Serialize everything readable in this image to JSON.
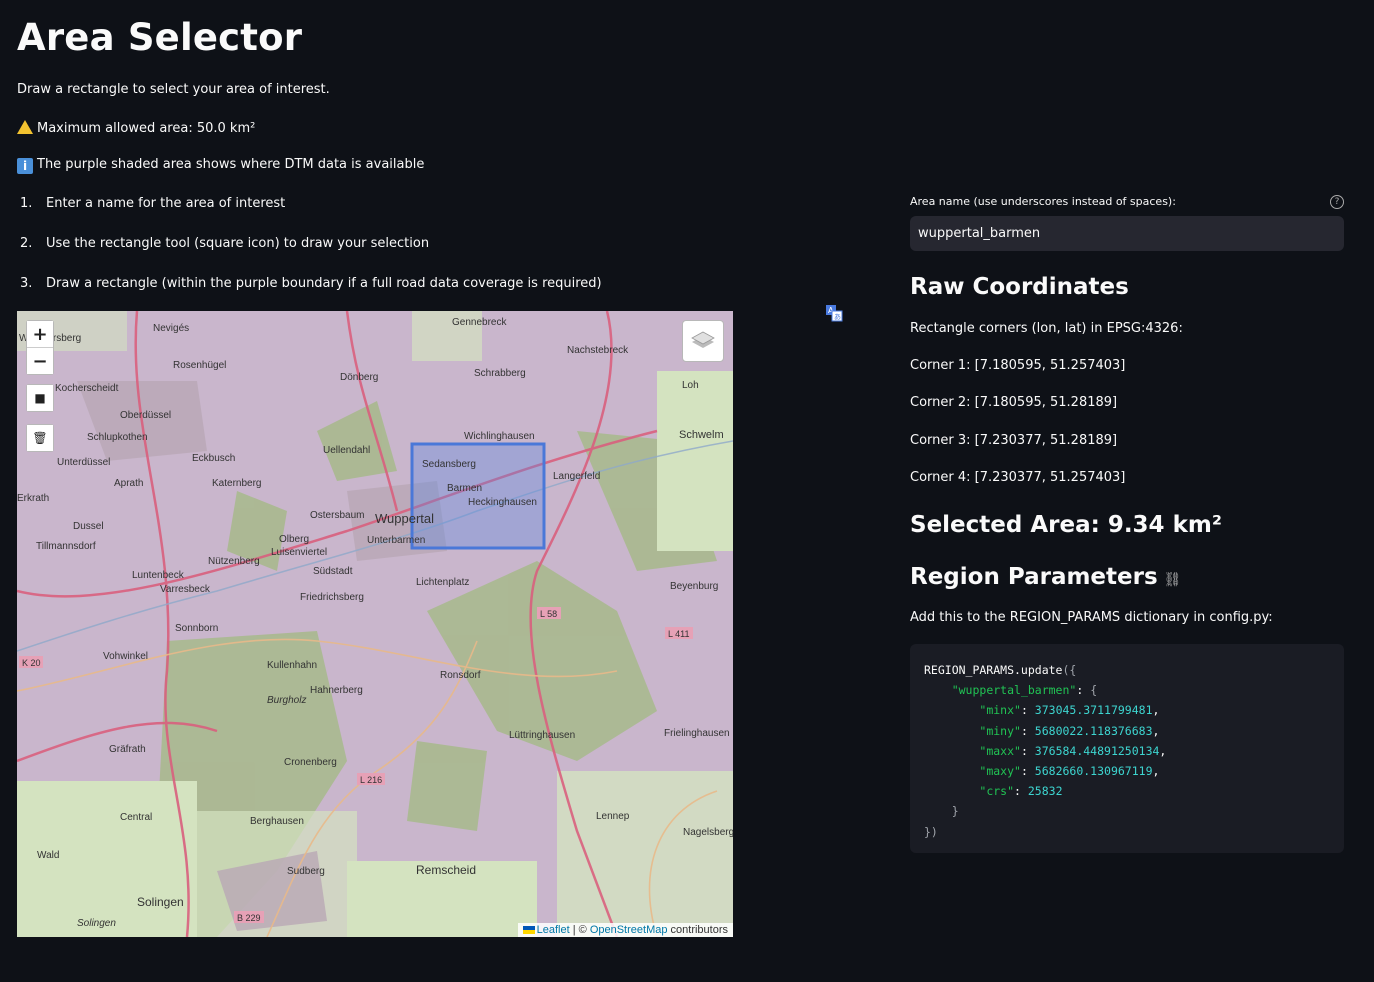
{
  "header": {
    "title": "Area Selector",
    "subtitle": "Draw a rectangle to select your area of interest.",
    "warning": "Maximum allowed area: 50.0 km²",
    "info": "The purple shaded area shows where DTM data is available"
  },
  "steps": [
    {
      "num": "1.",
      "text": "Enter a name for the area of interest"
    },
    {
      "num": "2.",
      "text": "Use the rectangle tool (square icon) to draw your selection"
    },
    {
      "num": "3.",
      "text": "Draw a rectangle (within the purple boundary if a full road data coverage is required)"
    }
  ],
  "map": {
    "zoom_in": "+",
    "zoom_out": "−",
    "draw_rect": "■",
    "delete": "🗑",
    "attribution_leaflet": "Leaflet",
    "attribution_sep": " | © ",
    "attribution_osm": "OpenStreetMap",
    "attribution_tail": " contributors",
    "places": [
      "Gennebreck",
      "Wimmersberg",
      "Nevigés",
      "Nachstebreck",
      "Rosenhügel",
      "Dönberg",
      "Schrabberg",
      "Loh",
      "Kocherscheidt",
      "Oberdüssel",
      "Schlupkothen",
      "Wichlinghausen",
      "Schwelm",
      "Unterdüssel",
      "Eckbusch",
      "Uellendahl",
      "Sedansberg",
      "Langerfeld",
      "Aprath",
      "Katernberg",
      "Barmen",
      "Heckinghausen",
      "Erkrath",
      "Dussel",
      "Ostersbaum",
      "Wuppertal",
      "Tillmannsdorf",
      "Olberg",
      "Unterbarmen",
      "Luisenviertel",
      "Nützenberg",
      "Südstadt",
      "Lichtenplatz",
      "Luntenbeck",
      "Varresbeck",
      "Friedrichsberg",
      "Beyenburg",
      "Sonnborn",
      "Vohwinkel",
      "Kullenhahn",
      "Ronsdorf",
      "Hahnerberg",
      "Burgholz",
      "Gräfrath",
      "Lüttringhausen",
      "Frielinghausen",
      "Cronenberg",
      "Central",
      "Berghausen",
      "Lennep",
      "Nagelsberg",
      "Wald",
      "Remscheid",
      "Sudberg",
      "Solingen",
      "Solingen"
    ],
    "roads": [
      "L 58",
      "L 411",
      "K 20",
      "L 216",
      "B 229"
    ]
  },
  "form": {
    "name_label": "Area name (use underscores instead of spaces):",
    "name_value": "wuppertal_barmen",
    "help": "?"
  },
  "coords": {
    "heading": "Raw Coordinates",
    "intro": "Rectangle corners (lon, lat) in EPSG:4326:",
    "corner1": "Corner 1: [7.180595, 51.257403]",
    "corner2": "Corner 2: [7.180595, 51.28189]",
    "corner3": "Corner 3: [7.230377, 51.28189]",
    "corner4": "Corner 4: [7.230377, 51.257403]"
  },
  "area": {
    "heading": "Selected Area: 9.34 km²"
  },
  "region": {
    "heading": "Region Parameters",
    "intro": "Add this to the REGION_PARAMS dictionary in config.py:",
    "code": {
      "fn": "REGION_PARAMS.update",
      "name": "\"wuppertal_barmen\"",
      "minx": "373045.3711799481",
      "miny": "5680022.118376683",
      "maxx": "376584.44891250134",
      "maxy": "5682660.130967119",
      "crs": "25832"
    }
  },
  "colors": {
    "background": "#0e1117",
    "input_bg": "#262730",
    "code_bg": "#1a1c24",
    "dtm_purple": "#b58ed0",
    "selection_blue": "#4a78d8"
  }
}
